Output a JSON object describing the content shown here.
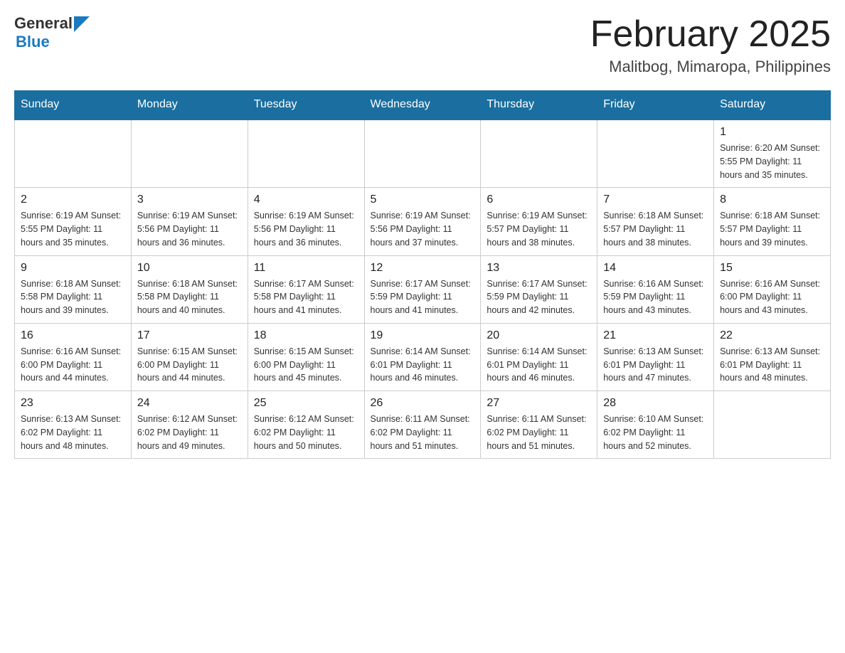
{
  "header": {
    "logo": {
      "general": "General",
      "triangle_symbol": "▶",
      "blue": "Blue"
    },
    "title": "February 2025",
    "location": "Malitbog, Mimaropa, Philippines"
  },
  "calendar": {
    "days_of_week": [
      "Sunday",
      "Monday",
      "Tuesday",
      "Wednesday",
      "Thursday",
      "Friday",
      "Saturday"
    ],
    "weeks": [
      {
        "days": [
          {
            "num": "",
            "info": ""
          },
          {
            "num": "",
            "info": ""
          },
          {
            "num": "",
            "info": ""
          },
          {
            "num": "",
            "info": ""
          },
          {
            "num": "",
            "info": ""
          },
          {
            "num": "",
            "info": ""
          },
          {
            "num": "1",
            "info": "Sunrise: 6:20 AM\nSunset: 5:55 PM\nDaylight: 11 hours and 35 minutes."
          }
        ]
      },
      {
        "days": [
          {
            "num": "2",
            "info": "Sunrise: 6:19 AM\nSunset: 5:55 PM\nDaylight: 11 hours and 35 minutes."
          },
          {
            "num": "3",
            "info": "Sunrise: 6:19 AM\nSunset: 5:56 PM\nDaylight: 11 hours and 36 minutes."
          },
          {
            "num": "4",
            "info": "Sunrise: 6:19 AM\nSunset: 5:56 PM\nDaylight: 11 hours and 36 minutes."
          },
          {
            "num": "5",
            "info": "Sunrise: 6:19 AM\nSunset: 5:56 PM\nDaylight: 11 hours and 37 minutes."
          },
          {
            "num": "6",
            "info": "Sunrise: 6:19 AM\nSunset: 5:57 PM\nDaylight: 11 hours and 38 minutes."
          },
          {
            "num": "7",
            "info": "Sunrise: 6:18 AM\nSunset: 5:57 PM\nDaylight: 11 hours and 38 minutes."
          },
          {
            "num": "8",
            "info": "Sunrise: 6:18 AM\nSunset: 5:57 PM\nDaylight: 11 hours and 39 minutes."
          }
        ]
      },
      {
        "days": [
          {
            "num": "9",
            "info": "Sunrise: 6:18 AM\nSunset: 5:58 PM\nDaylight: 11 hours and 39 minutes."
          },
          {
            "num": "10",
            "info": "Sunrise: 6:18 AM\nSunset: 5:58 PM\nDaylight: 11 hours and 40 minutes."
          },
          {
            "num": "11",
            "info": "Sunrise: 6:17 AM\nSunset: 5:58 PM\nDaylight: 11 hours and 41 minutes."
          },
          {
            "num": "12",
            "info": "Sunrise: 6:17 AM\nSunset: 5:59 PM\nDaylight: 11 hours and 41 minutes."
          },
          {
            "num": "13",
            "info": "Sunrise: 6:17 AM\nSunset: 5:59 PM\nDaylight: 11 hours and 42 minutes."
          },
          {
            "num": "14",
            "info": "Sunrise: 6:16 AM\nSunset: 5:59 PM\nDaylight: 11 hours and 43 minutes."
          },
          {
            "num": "15",
            "info": "Sunrise: 6:16 AM\nSunset: 6:00 PM\nDaylight: 11 hours and 43 minutes."
          }
        ]
      },
      {
        "days": [
          {
            "num": "16",
            "info": "Sunrise: 6:16 AM\nSunset: 6:00 PM\nDaylight: 11 hours and 44 minutes."
          },
          {
            "num": "17",
            "info": "Sunrise: 6:15 AM\nSunset: 6:00 PM\nDaylight: 11 hours and 44 minutes."
          },
          {
            "num": "18",
            "info": "Sunrise: 6:15 AM\nSunset: 6:00 PM\nDaylight: 11 hours and 45 minutes."
          },
          {
            "num": "19",
            "info": "Sunrise: 6:14 AM\nSunset: 6:01 PM\nDaylight: 11 hours and 46 minutes."
          },
          {
            "num": "20",
            "info": "Sunrise: 6:14 AM\nSunset: 6:01 PM\nDaylight: 11 hours and 46 minutes."
          },
          {
            "num": "21",
            "info": "Sunrise: 6:13 AM\nSunset: 6:01 PM\nDaylight: 11 hours and 47 minutes."
          },
          {
            "num": "22",
            "info": "Sunrise: 6:13 AM\nSunset: 6:01 PM\nDaylight: 11 hours and 48 minutes."
          }
        ]
      },
      {
        "days": [
          {
            "num": "23",
            "info": "Sunrise: 6:13 AM\nSunset: 6:02 PM\nDaylight: 11 hours and 48 minutes."
          },
          {
            "num": "24",
            "info": "Sunrise: 6:12 AM\nSunset: 6:02 PM\nDaylight: 11 hours and 49 minutes."
          },
          {
            "num": "25",
            "info": "Sunrise: 6:12 AM\nSunset: 6:02 PM\nDaylight: 11 hours and 50 minutes."
          },
          {
            "num": "26",
            "info": "Sunrise: 6:11 AM\nSunset: 6:02 PM\nDaylight: 11 hours and 51 minutes."
          },
          {
            "num": "27",
            "info": "Sunrise: 6:11 AM\nSunset: 6:02 PM\nDaylight: 11 hours and 51 minutes."
          },
          {
            "num": "28",
            "info": "Sunrise: 6:10 AM\nSunset: 6:02 PM\nDaylight: 11 hours and 52 minutes."
          },
          {
            "num": "",
            "info": ""
          }
        ]
      }
    ]
  }
}
